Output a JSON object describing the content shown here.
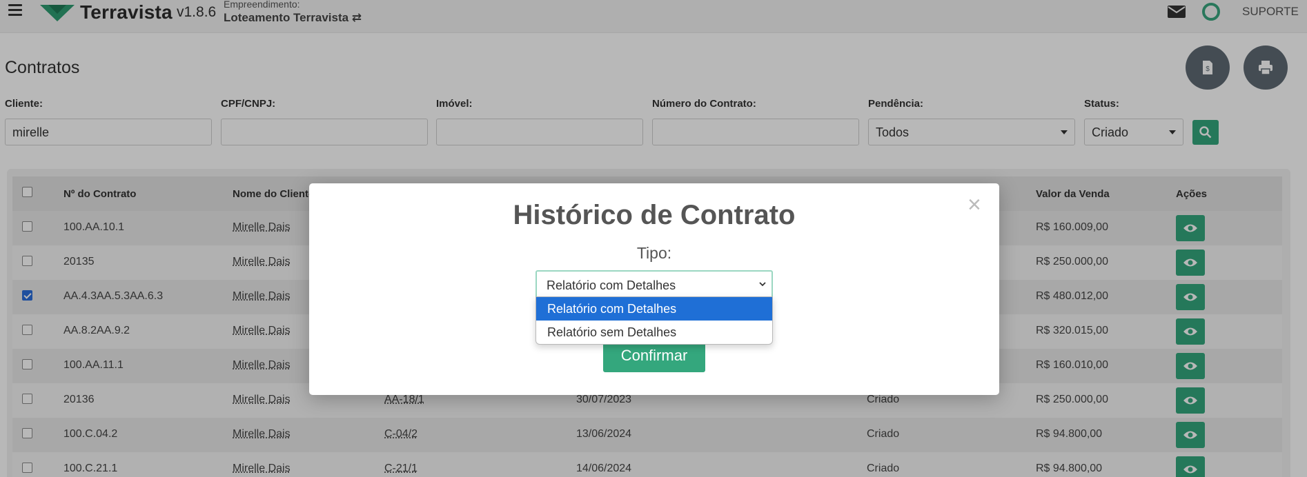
{
  "header": {
    "brand": "Terravista",
    "version": "v1.8.6",
    "emp_label": "Empreendimento:",
    "emp_name": "Loteamento Terravista ⇄",
    "support": "SUPORTE"
  },
  "page": {
    "title": "Contratos"
  },
  "filters": {
    "cliente_label": "Cliente:",
    "cliente_value": "mirelle",
    "cpf_label": "CPF/CNPJ:",
    "cpf_value": "",
    "imovel_label": "Imóvel:",
    "imovel_value": "",
    "numero_label": "Número do Contrato:",
    "numero_value": "",
    "pendencia_label": "Pendência:",
    "pendencia_value": "Todos",
    "status_label": "Status:",
    "status_value": "Criado"
  },
  "table": {
    "headers": {
      "numero": "Nº do Contrato",
      "nome": "Nome do Cliente",
      "valor": "Valor da Venda",
      "acoes": "Ações"
    },
    "rows": [
      {
        "numero": "100.AA.10.1",
        "nome": "Mirelle Dais",
        "imovel": "",
        "data": "",
        "status": "",
        "valor": "R$ 160.009,00",
        "checked": false
      },
      {
        "numero": "20135",
        "nome": "Mirelle Dais",
        "imovel": "",
        "data": "",
        "status": "",
        "valor": "R$ 250.000,00",
        "checked": false
      },
      {
        "numero": "AA.4.3AA.5.3AA.6.3",
        "nome": "Mirelle Dais",
        "imovel": "",
        "data": "",
        "status": "",
        "valor": "R$ 480.012,00",
        "checked": true
      },
      {
        "numero": "AA.8.2AA.9.2",
        "nome": "Mirelle Dais",
        "imovel": "",
        "data": "",
        "status": "",
        "valor": "R$ 320.015,00",
        "checked": false
      },
      {
        "numero": "100.AA.11.1",
        "nome": "Mirelle Dais",
        "imovel": "",
        "data": "",
        "status": "",
        "valor": "R$ 160.010,00",
        "checked": false
      },
      {
        "numero": "20136",
        "nome": "Mirelle Dais",
        "imovel": "AA-18/1",
        "data": "30/07/2023",
        "status": "Criado",
        "valor": "R$ 250.000,00",
        "checked": false
      },
      {
        "numero": "100.C.04.2",
        "nome": "Mirelle Dais",
        "imovel": "C-04/2",
        "data": "13/06/2024",
        "status": "Criado",
        "valor": "R$ 94.800,00",
        "checked": false
      },
      {
        "numero": "100.C.21.1",
        "nome": "Mirelle Dais",
        "imovel": "C-21/1",
        "data": "14/06/2024",
        "status": "Criado",
        "valor": "R$ 94.800,00",
        "checked": false
      }
    ]
  },
  "modal": {
    "title": "Histórico de Contrato",
    "tipo_label": "Tipo:",
    "selected": "Relatório com Detalhes",
    "options": [
      "Relatório com Detalhes",
      "Relatório sem Detalhes"
    ],
    "confirm_label": "Confirmar",
    "close_glyph": "×"
  },
  "colors": {
    "accent": "#34a77d",
    "dropdown_selected": "#1f6fd6"
  }
}
